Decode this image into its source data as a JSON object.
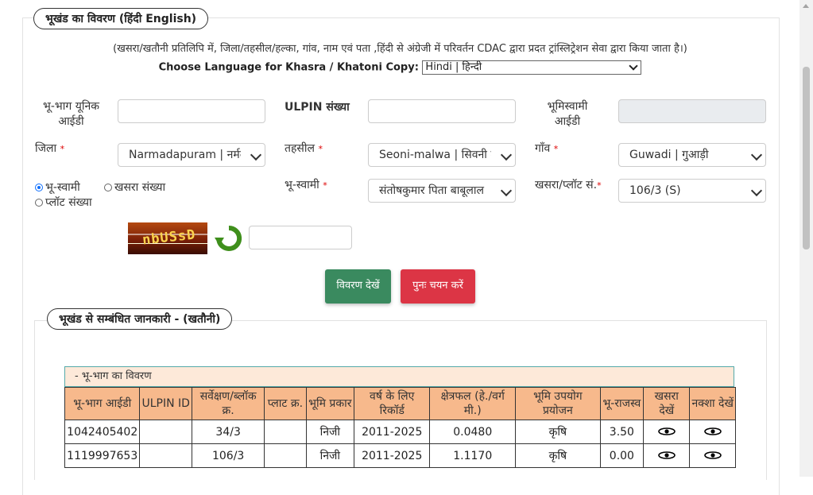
{
  "section1": {
    "title": "भूखंड का विवरण  (हिंदी  English)",
    "note": "(खसरा/खतौनी प्रतिलिपि में, जिला/तहसील/हल्का, गांव, नाम एवं पता ,हिंदी से अंग्रेजी में परिवर्तन CDAC द्वारा प्रदत ट्रांस्लिट्रेशन सेवा द्वारा किया जाता है।)",
    "language_label": "Choose Language for Khasra / Khatoni Copy:",
    "language_value": "Hindi | हिन्दी"
  },
  "form": {
    "unique_id_label": "भू-भाग यूनिक आईडी",
    "ulpin_label": "ULPIN संख्या",
    "owner_id_label": "भूमिस्वामी आईडी",
    "district_label": "जिला",
    "district_value": "Narmadapuram | नर्मदापुरम",
    "tehsil_label": "तहसील",
    "tehsil_value": "Seoni-malwa | सिवनी मालवा",
    "village_label": "गाँव",
    "village_value": "Guwadi | गुआड़ी",
    "owner_label": "भू-स्वामी",
    "owner_value": "संतोषकुमार पिता बाबूलाल",
    "khasra_label": "खसरा/प्लॉट सं.",
    "khasra_value": "106/3 (S)",
    "required_mark": "*",
    "radio_owner": "भू-स्वामी",
    "radio_khasra": "खसरा संख्या",
    "radio_plot": "प्लॉट संख्या",
    "captcha_text": "nbUSsD",
    "view_button": "विवरण देखें",
    "reset_button": "पुनः चयन करें"
  },
  "section2": {
    "title": "भूखंड से सम्बंधित जानकारी -   (खतौनी)",
    "table_caption": "- भू-भाग का विवरण",
    "headers": [
      "भू-भाग आईडी",
      "ULPIN ID",
      "सर्वेक्षण/ब्लॉक क्र.",
      "प्लाट क्र.",
      "भूमि प्रकार",
      "वर्ष के लिए रिकॉर्ड",
      "क्षेत्रफल (हे./वर्ग मी.)",
      "भूमि उपयोग प्रयोजन",
      "भू-राजस्व",
      "खसरा देखें",
      "नक्शा देखें"
    ],
    "rows": [
      [
        "1042405402",
        "",
        "34/3",
        "",
        "निजी",
        "2011-2025",
        "0.0480",
        "कृषि",
        "3.50"
      ],
      [
        "1119997653",
        "",
        "106/3",
        "",
        "निजी",
        "2011-2025",
        "1.1170",
        "कृषि",
        "0.00"
      ]
    ]
  },
  "colors": {
    "view_button": "#3a8a5f",
    "reset_button": "#dc3545",
    "table_header": "#f7b98c",
    "caption_bg": "#fde9d9"
  }
}
